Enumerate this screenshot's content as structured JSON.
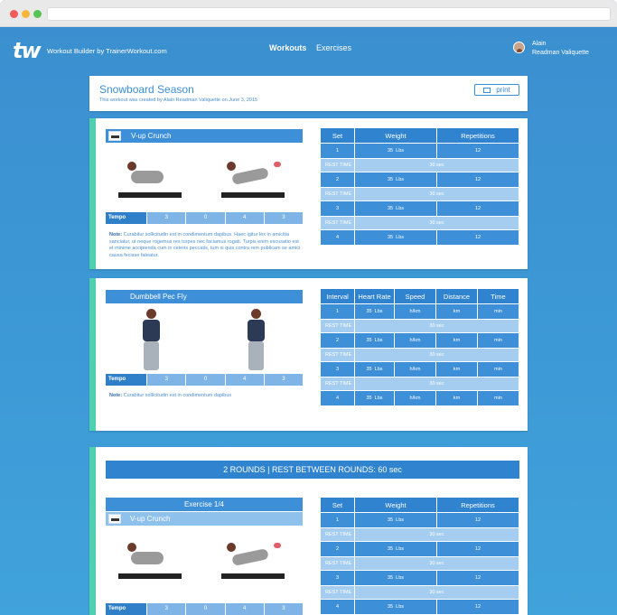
{
  "colors": {
    "accent": "#3d8fd8",
    "stripe": "#4fd1b0",
    "dot_red": "#f05b5b",
    "dot_yellow": "#f5b73b",
    "dot_green": "#56c454"
  },
  "nav": {
    "logo": "tw",
    "brand": "Workout Builder by TrainerWorkout.com",
    "links": [
      "Workouts",
      "Exercises"
    ],
    "user_first": "Alain",
    "user_full": "Readman Valiquette"
  },
  "header": {
    "title": "Snowboard Season",
    "subtitle": "This workout was created by Alain Readman Valiquette on June 3, 2015",
    "print": "print"
  },
  "ex1": {
    "name": "V-up Crunch",
    "tempo_label": "Tempo",
    "tempo": [
      "3",
      "0",
      "4",
      "3"
    ],
    "note_label": "Note:",
    "note": "Curabitur sollicitudin est in condimentum dapibus. Haec igitur lex in amicitia sanciatur, ut neque rogemus res turpes nec faciamus rogati. Turpis enim excusatio est et minime accipienda cum in ceteris peccatis, tum si quis contra rem publicam se amici causa fecisse fateatur.",
    "headers": [
      "Set",
      "Weight",
      "Repetitions"
    ],
    "rest_label": "REST TIME",
    "rest_value": "30 sec",
    "sets": [
      {
        "n": "1",
        "w": "35",
        "u": "Lbs",
        "r": "12"
      },
      {
        "n": "2",
        "w": "35",
        "u": "Lbs",
        "r": "12"
      },
      {
        "n": "3",
        "w": "35",
        "u": "Lbs",
        "r": "12"
      },
      {
        "n": "4",
        "w": "35",
        "u": "Lbs",
        "r": "12"
      }
    ]
  },
  "ex2": {
    "name": "Dumbbell Pec Fly",
    "tempo_label": "Tempo",
    "tempo": [
      "3",
      "0",
      "4",
      "3"
    ],
    "note_label": "Note:",
    "note": "Curabitur sollicitudin est in condimentum dapibus",
    "headers": [
      "Interval",
      "Heart Rate",
      "Speed",
      "Distance",
      "Time"
    ],
    "rest_label": "REST TIME",
    "rest_value": "30 sec",
    "rows": [
      {
        "n": "1",
        "hr": "35",
        "u": "Lbs",
        "s": "h/km",
        "d": "km",
        "t": "min"
      },
      {
        "n": "2",
        "hr": "35",
        "u": "Lbs",
        "s": "h/km",
        "d": "km",
        "t": "min"
      },
      {
        "n": "3",
        "hr": "35",
        "u": "Lbs",
        "s": "h/km",
        "d": "km",
        "t": "min"
      },
      {
        "n": "4",
        "hr": "35",
        "u": "Lbs",
        "s": "h/km",
        "d": "km",
        "t": "min"
      }
    ]
  },
  "circuit": {
    "banner": "2 ROUNDS | REST BETWEEN ROUNDS: 60 sec",
    "exercise_label": "Exercise 1/4",
    "name": "V-up Crunch",
    "tempo_label": "Tempo",
    "tempo": [
      "3",
      "0",
      "4",
      "3"
    ],
    "headers": [
      "Set",
      "Weight",
      "Repetitions"
    ],
    "rest_label": "REST TIME",
    "rest_value": "30 sec",
    "sets": [
      {
        "n": "1",
        "w": "35",
        "u": "Lbs",
        "r": "12"
      },
      {
        "n": "2",
        "w": "35",
        "u": "Lbs",
        "r": "12"
      },
      {
        "n": "3",
        "w": "35",
        "u": "Lbs",
        "r": "12"
      },
      {
        "n": "4",
        "w": "35",
        "u": "Lbs",
        "r": "12"
      }
    ]
  }
}
